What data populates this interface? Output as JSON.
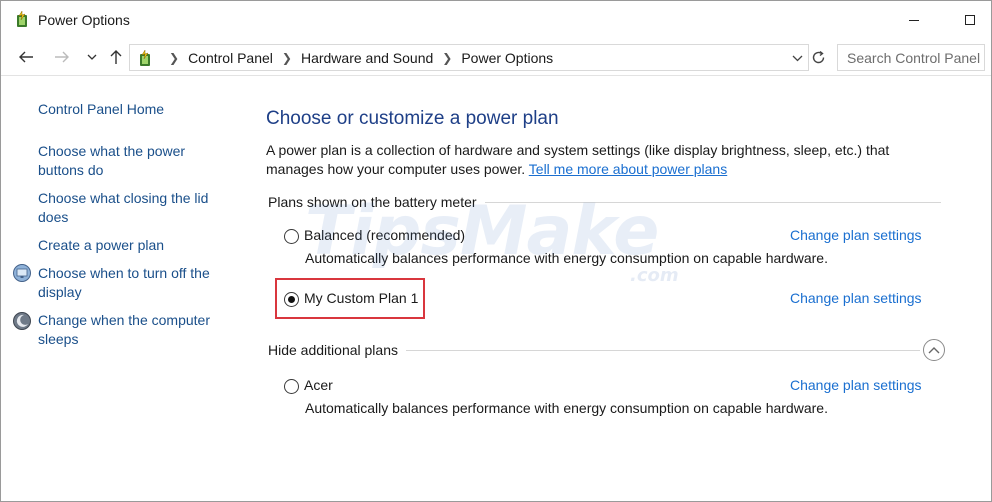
{
  "window": {
    "title": "Power Options",
    "icon": "power-options-icon"
  },
  "nav": {
    "back_icon": "arrow-left-icon",
    "forward_icon": "arrow-right-icon",
    "recent_icon": "chevron-down-icon",
    "up_icon": "arrow-up-icon",
    "breadcrumbs": [
      "Control Panel",
      "Hardware and Sound",
      "Power Options"
    ],
    "refresh_icon": "refresh-icon",
    "search_placeholder": "Search Control Panel"
  },
  "sidebar": {
    "home": "Control Panel Home",
    "links": [
      {
        "label_line1": "Choose what the power",
        "label_line2": "buttons do",
        "icon": ""
      },
      {
        "label_line1": "Choose what closing the lid",
        "label_line2": "does",
        "icon": ""
      },
      {
        "label_line1": "Create a power plan",
        "label_line2": "",
        "icon": ""
      },
      {
        "label_line1": "Choose when to turn off the",
        "label_line2": "display",
        "icon": "display-icon"
      },
      {
        "label_line1": "Change when the computer",
        "label_line2": "sleeps",
        "icon": "moon-sleep-icon"
      }
    ]
  },
  "main": {
    "title": "Choose or customize a power plan",
    "description": "A power plan is a collection of hardware and system settings (like display brightness, sleep, etc.) that manages how your computer uses power.",
    "learn_more": "Tell me more about power plans",
    "section_battery": "Plans shown on the battery meter",
    "section_additional": "Hide additional plans",
    "change_link": "Change plan settings",
    "plans": [
      {
        "name": "Balanced (recommended)",
        "description": "Automatically balances performance with energy consumption on capable hardware.",
        "selected": false
      },
      {
        "name": "My Custom Plan 1",
        "description": "",
        "selected": true
      },
      {
        "name": "Acer",
        "description": "Automatically balances performance with energy consumption on capable hardware.",
        "selected": false
      }
    ]
  },
  "watermark": {
    "main": "TipsMake",
    "sub": ".com"
  },
  "colors": {
    "link": "#1a6fd0",
    "title": "#1e3f87",
    "highlight": "#d9363e"
  }
}
